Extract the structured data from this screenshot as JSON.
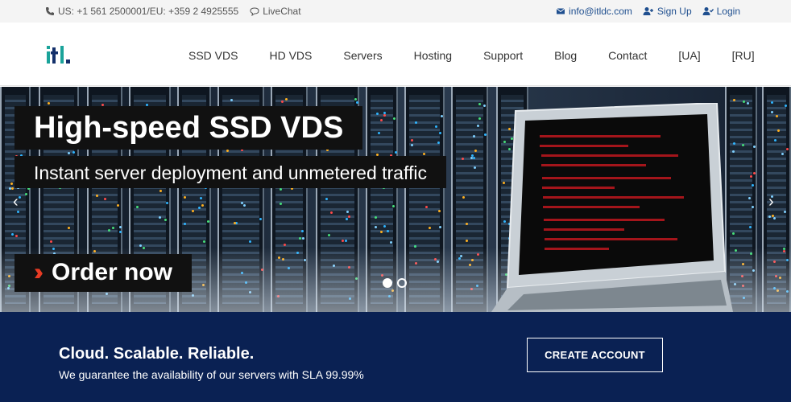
{
  "topbar": {
    "phone": "US: +1 561 2500001/EU: +359 2 4925555",
    "livechat": "LiveChat",
    "email": "info@itldc.com",
    "signup": "Sign Up",
    "login": "Login"
  },
  "header": {
    "logo_text": "iTL.",
    "nav": [
      "SSD VDS",
      "HD VDS",
      "Servers",
      "Hosting",
      "Support",
      "Blog",
      "Contact",
      "[UA]",
      "[RU]"
    ]
  },
  "hero": {
    "title": "High-speed SSD VDS",
    "subtitle": "Instant server deployment and unmetered traffic",
    "order": "Order now",
    "prev": "‹",
    "next": "›"
  },
  "band": {
    "headline": "Cloud. Scalable. Reliable.",
    "text": "We guarantee the availability of our servers with SLA 99.99%",
    "button": "CREATE ACCOUNT"
  },
  "colors": {
    "accent": "#0a2153",
    "link": "#1f4f8f",
    "logo_teal": "#1aa39a",
    "logo_navy": "#14306b",
    "order_red": "#e63b24"
  }
}
